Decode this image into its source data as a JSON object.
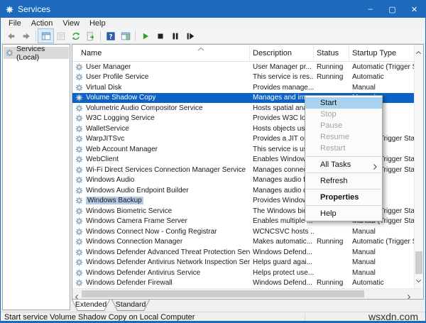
{
  "window": {
    "title": "Services"
  },
  "titlebar": {
    "minimize": "–",
    "maximize": "▢",
    "close": "✕"
  },
  "menubar": {
    "items": [
      "File",
      "Action",
      "View",
      "Help"
    ]
  },
  "toolbar": {
    "items": [
      {
        "icon": "back-icon",
        "enabled": true
      },
      {
        "icon": "forward-icon",
        "enabled": true
      },
      {
        "sep": true
      },
      {
        "icon": "show-console-tree-icon",
        "enabled": true,
        "active": true
      },
      {
        "icon": "properties-icon",
        "enabled": false
      },
      {
        "icon": "refresh-icon",
        "enabled": true
      },
      {
        "icon": "export-list-icon",
        "enabled": true
      },
      {
        "sep": true
      },
      {
        "icon": "help-icon",
        "enabled": true
      },
      {
        "icon": "show-action-pane-icon",
        "enabled": true
      },
      {
        "sep": true
      },
      {
        "icon": "start-service-icon",
        "enabled": true
      },
      {
        "icon": "stop-service-icon",
        "enabled": true
      },
      {
        "icon": "pause-service-icon",
        "enabled": true
      },
      {
        "icon": "restart-service-icon",
        "enabled": true
      }
    ]
  },
  "tree": {
    "root": "Services (Local)"
  },
  "table": {
    "columns": [
      "Name",
      "Description",
      "Status",
      "Startup Type"
    ],
    "sort": "ascending",
    "rows": [
      {
        "name": "User Manager",
        "desc": "User Manager pr...",
        "status": "Running",
        "startup": "Automatic (Trigger Start)",
        "state": ""
      },
      {
        "name": "User Profile Service",
        "desc": "This service is res...",
        "status": "Running",
        "startup": "Automatic",
        "state": ""
      },
      {
        "name": "Virtual Disk",
        "desc": "Provides manage...",
        "status": "",
        "startup": "Manual",
        "state": ""
      },
      {
        "name": "Volume Shadow Copy",
        "desc": "Manages and im...",
        "status": "",
        "startup": "Manual",
        "state": "selected"
      },
      {
        "name": "Volumetric Audio Compositor Service",
        "desc": "Hosts spatial anal...",
        "status": "",
        "startup": "",
        "state": ""
      },
      {
        "name": "W3C Logging Service",
        "desc": "Provides W3C lo...",
        "status": "",
        "startup": "",
        "state": ""
      },
      {
        "name": "WalletService",
        "desc": "Hosts objects use...",
        "status": "",
        "startup": "",
        "state": ""
      },
      {
        "name": "WarpJITSvc",
        "desc": "Provides a JIT out...",
        "status": "",
        "startup": "Manual (Trigger Start)",
        "state": ""
      },
      {
        "name": "Web Account Manager",
        "desc": "This service is use...",
        "status": "",
        "startup": "",
        "state": ""
      },
      {
        "name": "WebClient",
        "desc": "Enables Windows...",
        "status": "",
        "startup": "Manual (Trigger Start)",
        "state": ""
      },
      {
        "name": "Wi-Fi Direct Services Connection Manager Service",
        "desc": "Manages connec...",
        "status": "",
        "startup": "Manual (Trigger Start)",
        "state": ""
      },
      {
        "name": "Windows Audio",
        "desc": "Manages audio f...",
        "status": "",
        "startup": "",
        "state": ""
      },
      {
        "name": "Windows Audio Endpoint Builder",
        "desc": "Manages audio d...",
        "status": "",
        "startup": "",
        "state": ""
      },
      {
        "name": "Windows Backup",
        "desc": "Provides Window...",
        "status": "",
        "startup": "",
        "state": "inactive-selected"
      },
      {
        "name": "Windows Biometric Service",
        "desc": "The Windows bio...",
        "status": "",
        "startup": "Manual (Trigger Start)",
        "state": ""
      },
      {
        "name": "Windows Camera Frame Server",
        "desc": "Enables multiple ...",
        "status": "",
        "startup": "Manual (Trigger Start)",
        "state": ""
      },
      {
        "name": "Windows Connect Now - Config Registrar",
        "desc": "WCNCSVC hosts ...",
        "status": "",
        "startup": "Manual",
        "state": ""
      },
      {
        "name": "Windows Connection Manager",
        "desc": "Makes automatic...",
        "status": "Running",
        "startup": "Automatic (Trigger Start)",
        "state": ""
      },
      {
        "name": "Windows Defender Advanced Threat Protection Service",
        "desc": "Windows Defend...",
        "status": "",
        "startup": "Manual",
        "state": ""
      },
      {
        "name": "Windows Defender Antivirus Network Inspection Service",
        "desc": "Helps guard agai...",
        "status": "",
        "startup": "Manual",
        "state": ""
      },
      {
        "name": "Windows Defender Antivirus Service",
        "desc": "Helps protect use...",
        "status": "",
        "startup": "Manual",
        "state": ""
      },
      {
        "name": "Windows Defender Firewall",
        "desc": "Windows Defend...",
        "status": "Running",
        "startup": "Automatic",
        "state": ""
      }
    ]
  },
  "context_menu": {
    "items": [
      {
        "label": "Start",
        "state": "highlighted"
      },
      {
        "label": "Stop",
        "state": "disabled"
      },
      {
        "label": "Pause",
        "state": "disabled"
      },
      {
        "label": "Resume",
        "state": "disabled"
      },
      {
        "label": "Restart",
        "state": "disabled"
      },
      {
        "separator": true
      },
      {
        "label": "All Tasks",
        "submenu": true
      },
      {
        "separator": true
      },
      {
        "label": "Refresh"
      },
      {
        "separator": true
      },
      {
        "label": "Properties",
        "bold": true
      },
      {
        "separator": true
      },
      {
        "label": "Help"
      }
    ]
  },
  "tabs": [
    {
      "label": "Extended",
      "active": true
    },
    {
      "label": "Standard",
      "active": false
    }
  ],
  "statusbar": {
    "text": "Start service Volume Shadow Copy on Local Computer",
    "watermark": "wsxdn.com"
  },
  "colors": {
    "titlebar": "#1d69bc",
    "selection": "#0d63c5",
    "menu_highlight": "#a9d2f1",
    "inactive_selection": "#b6c9e2",
    "start_green": "#2ca02c",
    "refresh_green": "#3aa13a",
    "help_blue": "#2b5da8"
  }
}
